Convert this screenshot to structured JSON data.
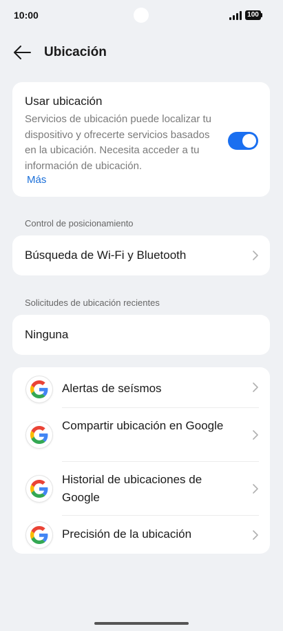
{
  "status_bar": {
    "time": "10:00",
    "battery": "100"
  },
  "header": {
    "title": "Ubicación"
  },
  "location_card": {
    "title": "Usar ubicación",
    "description": "Servicios de ubicación puede localizar tu dispositivo y ofrecerte servicios basados en la ubicación. Necesita acceder a tu información de ubicación.",
    "more_link": "Más",
    "toggle_on": true
  },
  "positioning_section": {
    "label": "Control de posicionamiento",
    "wifi_bluetooth": "Búsqueda de Wi-Fi y Bluetooth"
  },
  "recent_requests": {
    "label": "Solicitudes de ubicación recientes",
    "value": "Ninguna"
  },
  "google_services": [
    {
      "label": "Alertas de seísmos",
      "icon": "google-icon"
    },
    {
      "label": "Compartir ubicación en Google",
      "icon": "google-icon"
    },
    {
      "label": "Historial de ubicaciones de Google",
      "icon": "google-icon"
    },
    {
      "label": "Precisión de la ubicación",
      "icon": "google-icon"
    }
  ],
  "colors": {
    "accent": "#1a6ff0",
    "link": "#1a6fd9",
    "background": "#eff1f4"
  }
}
